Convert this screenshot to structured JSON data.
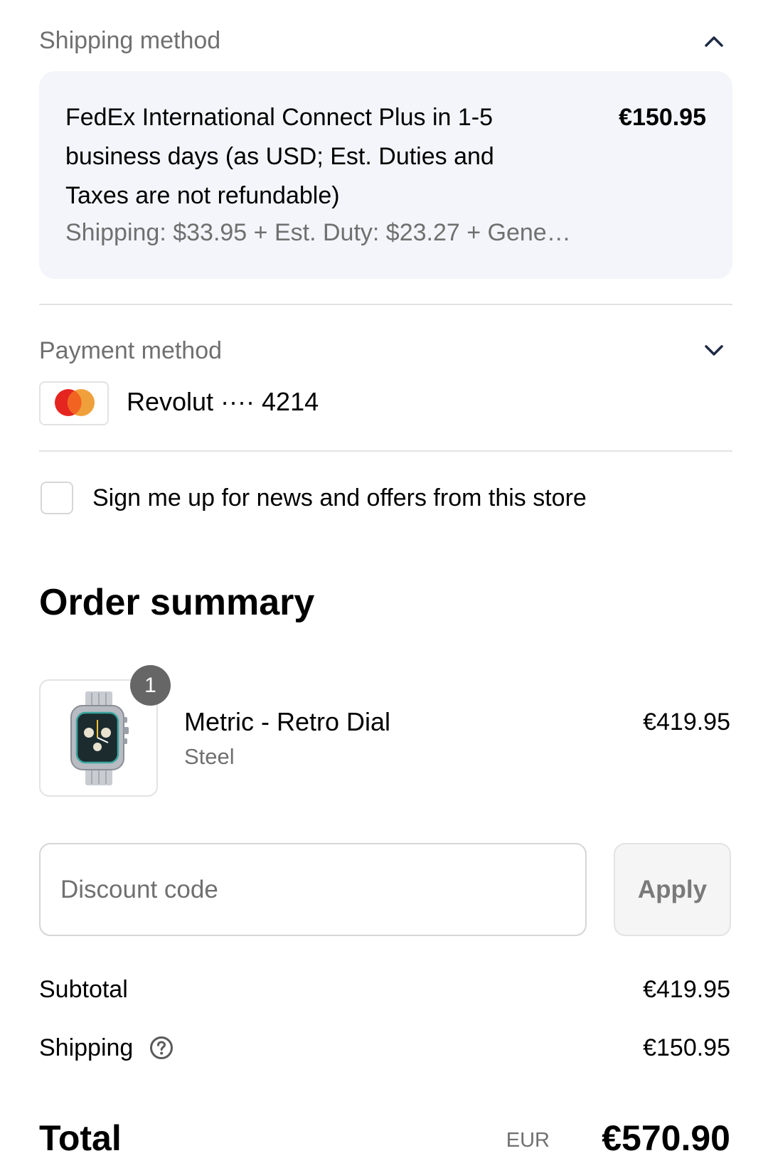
{
  "shipping": {
    "title": "Shipping method",
    "option_name": "FedEx International Connect Plus in 1-5 business days (as USD; Est. Duties and Taxes are not refundable)",
    "option_price": "€150.95",
    "option_detail": "Shipping: $33.95 + Est. Duty: $23.27 + Gene…"
  },
  "payment": {
    "title": "Payment method",
    "card_brand_icon": "mastercard-icon",
    "card_label": "Revolut ···· 4214"
  },
  "newsletter": {
    "label": "Sign me up for news and offers from this store",
    "checked": false
  },
  "order_summary": {
    "title": "Order summary",
    "items": [
      {
        "quantity": "1",
        "name": "Metric - Retro Dial",
        "variant": "Steel",
        "price": "€419.95"
      }
    ]
  },
  "discount": {
    "placeholder": "Discount code",
    "apply_label": "Apply"
  },
  "totals": {
    "subtotal_label": "Subtotal",
    "subtotal_value": "€419.95",
    "shipping_label": "Shipping",
    "shipping_value": "€150.95",
    "total_label": "Total",
    "currency": "EUR",
    "total_value": "€570.90"
  },
  "colors": {
    "muted_text": "#707070",
    "panel_bg": "#f4f5fa",
    "divider": "#e3e3e3",
    "chevron": "#1f2a44"
  }
}
